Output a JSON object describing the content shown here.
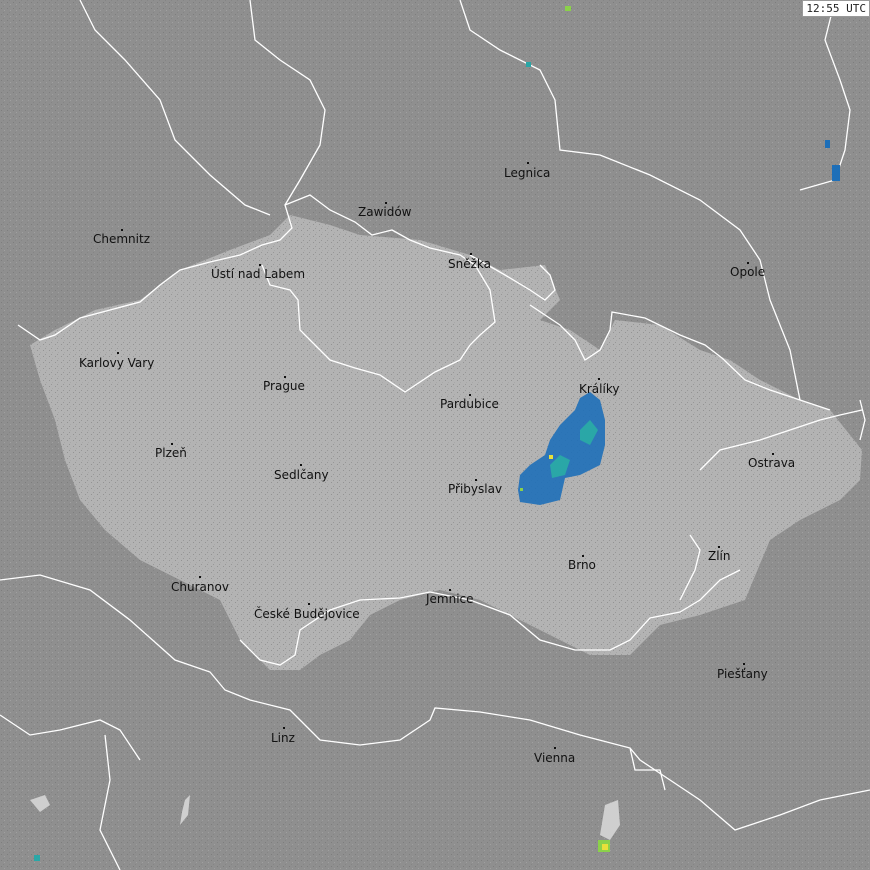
{
  "timestamp": "12:55 UTC",
  "colors": {
    "background": "#8f8f8f",
    "highlight_region": "#b3b3b3",
    "border_line": "#ffffff",
    "precip_blue": "#1e6fb8",
    "precip_teal": "#2aa7a7",
    "precip_green": "#8bd14a",
    "precip_yellow": "#e8e03a"
  },
  "cities": [
    {
      "id": "chemnitz",
      "label": "Chemnitz"
    },
    {
      "id": "zawidow",
      "label": "Zawidów"
    },
    {
      "id": "legnica",
      "label": "Legnica"
    },
    {
      "id": "usti",
      "label": "Ústí nad Labem"
    },
    {
      "id": "snezka",
      "label": "Sněžka"
    },
    {
      "id": "opole",
      "label": "Opole"
    },
    {
      "id": "karlovy-vary",
      "label": "Karlovy Vary"
    },
    {
      "id": "prague",
      "label": "Prague"
    },
    {
      "id": "kraliky",
      "label": "Králíky"
    },
    {
      "id": "pardubice",
      "label": "Pardubice"
    },
    {
      "id": "plzen",
      "label": "Plzeň"
    },
    {
      "id": "ostrava",
      "label": "Ostrava"
    },
    {
      "id": "sedlcany",
      "label": "Sedlčany"
    },
    {
      "id": "pribyslav",
      "label": "Přibyslav"
    },
    {
      "id": "zlin",
      "label": "Zlín"
    },
    {
      "id": "brno",
      "label": "Brno"
    },
    {
      "id": "churanov",
      "label": "Churanov"
    },
    {
      "id": "jemnice",
      "label": "Jemnice"
    },
    {
      "id": "ceske-budejovice",
      "label": "České Budějovice"
    },
    {
      "id": "piestany",
      "label": "Piešťany"
    },
    {
      "id": "linz",
      "label": "Linz"
    },
    {
      "id": "vienna",
      "label": "Vienna"
    }
  ]
}
